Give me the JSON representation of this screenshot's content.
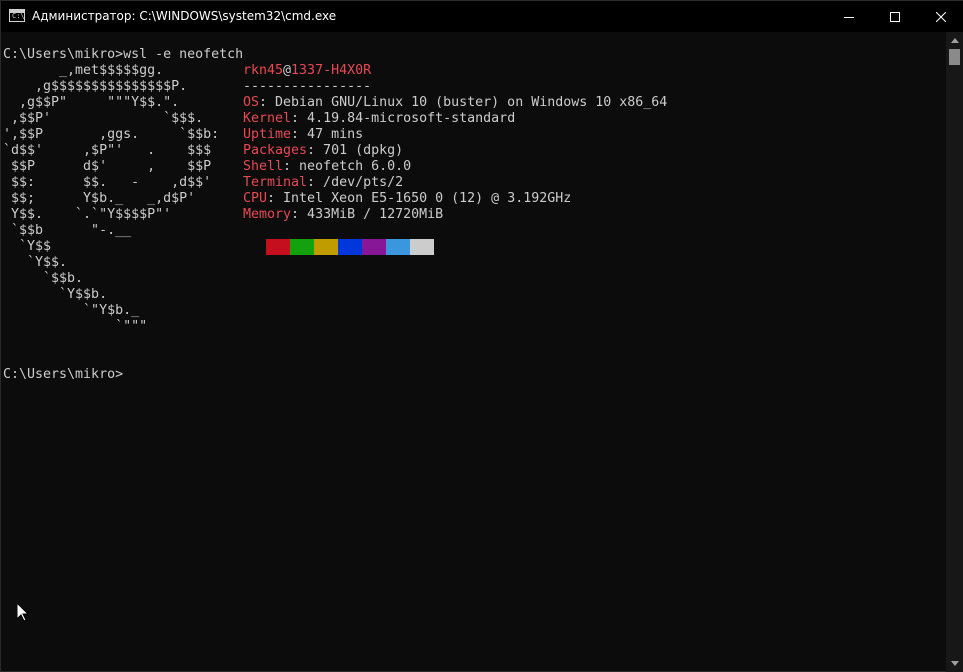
{
  "window": {
    "title": "Администратор: C:\\WINDOWS\\system32\\cmd.exe",
    "icon_label": "C:\\",
    "minimize_icon": "minimize-icon",
    "maximize_icon": "maximize-icon",
    "close_icon": "close-icon"
  },
  "console": {
    "command_line": "C:\\Users\\mikro>wsl -e neofetch",
    "prompt_line": "C:\\Users\\mikro>",
    "ascii_art": [
      [
        "       _,met$$$$$gg.",
        ""
      ],
      [
        "    ,g$$$$$$$$$$$$$$$P.",
        ""
      ],
      [
        "  ,g$$P\"     \"\"\"Y$$.\".",
        ""
      ],
      [
        " ,$$P'              `$$$.",
        ""
      ],
      [
        "',$$P       ,ggs.     `$$b:",
        ""
      ],
      [
        "`d$$'     ,$P\"'   .    $$$",
        ""
      ],
      [
        " $$P      d$'     ,    $$P",
        ""
      ],
      [
        " $$:      $$.   -    ,d$$'",
        ""
      ],
      [
        " $$;      Y$b._   _,d$P'",
        ""
      ],
      [
        " Y$$.    `.`\"Y$$$$P\"'",
        ""
      ],
      [
        " `$$b      \"-.__",
        ""
      ],
      [
        "  `Y$$",
        ""
      ],
      [
        "   `Y$$.",
        ""
      ],
      [
        "     `$$b.",
        ""
      ],
      [
        "       `Y$$b.",
        ""
      ],
      [
        "          `\"Y$b._",
        ""
      ],
      [
        "              `\"\"\"",
        ""
      ]
    ],
    "user": "rkn45",
    "at": "@",
    "host": "1337-H4X0R",
    "separator": "----------------",
    "info": [
      {
        "key": "OS",
        "value": ": Debian GNU/Linux 10 (buster) on Windows 10 x86_64"
      },
      {
        "key": "Kernel",
        "value": ": 4.19.84-microsoft-standard"
      },
      {
        "key": "Uptime",
        "value": ": 47 mins"
      },
      {
        "key": "Packages",
        "value": ": 701 (dpkg)"
      },
      {
        "key": "Shell",
        "value": ": neofetch 6.0.0"
      },
      {
        "key": "Terminal",
        "value": ": /dev/pts/2"
      },
      {
        "key": "CPU",
        "value": ": Intel Xeon E5-1650 0 (12) @ 3.192GHz"
      },
      {
        "key": "Memory",
        "value": ": 433MiB / 12720MiB"
      }
    ],
    "palette": [
      "#c50f1f",
      "#13a10e",
      "#c19c00",
      "#0037da",
      "#881798",
      "#3a96dd",
      "#cccccc"
    ]
  },
  "colors": {
    "background": "#0c0c0c",
    "foreground": "#cccccc",
    "accent_red": "#e74856",
    "art_red": "#c50f1f",
    "titlebar": "#000000"
  },
  "scrollbar": {
    "up_icon": "chevron-up-icon",
    "down_icon": "chevron-down-icon"
  }
}
